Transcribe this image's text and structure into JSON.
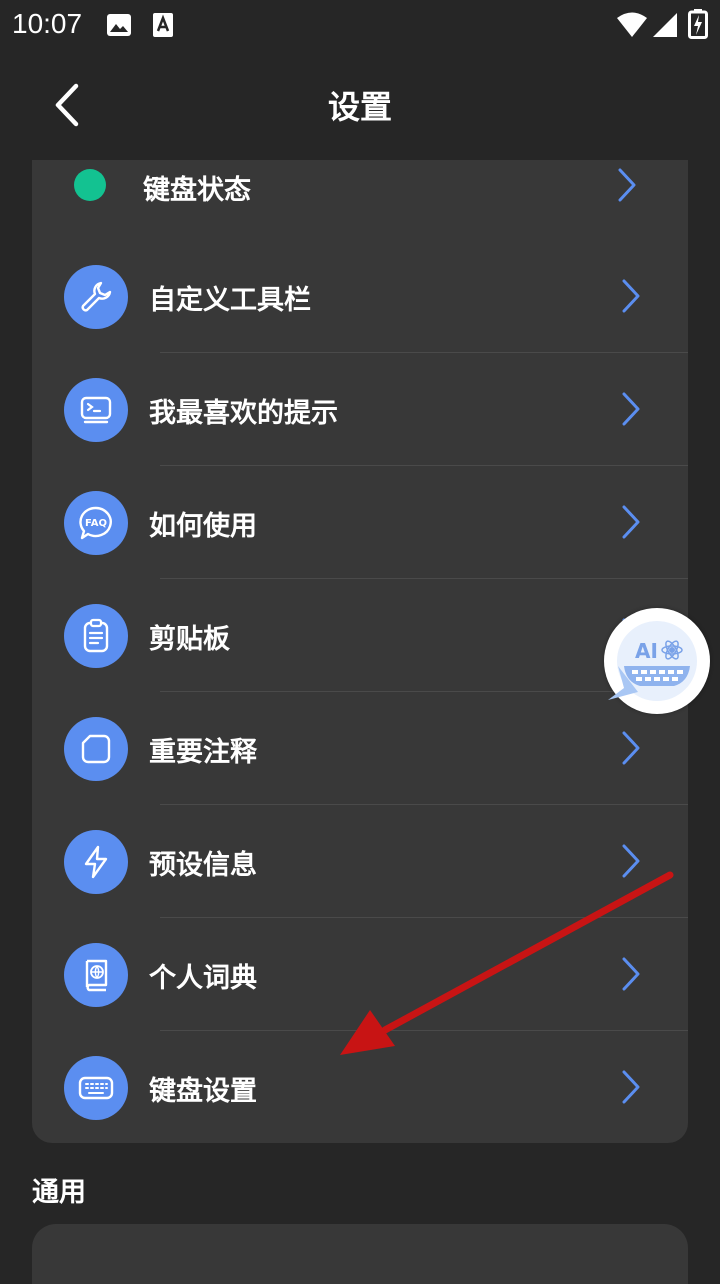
{
  "status_bar": {
    "time": "10:07"
  },
  "header": {
    "title": "设置"
  },
  "items": [
    {
      "label": "键盘状态"
    },
    {
      "label": "自定义工具栏",
      "icon": "wrench-icon"
    },
    {
      "label": "我最喜欢的提示",
      "icon": "terminal-icon"
    },
    {
      "label": "如何使用",
      "icon": "faq-icon",
      "icon_text": "FAQ"
    },
    {
      "label": "剪贴板",
      "icon": "clipboard-icon"
    },
    {
      "label": "重要注释",
      "icon": "note-icon"
    },
    {
      "label": "预设信息",
      "icon": "lightning-icon"
    },
    {
      "label": "个人词典",
      "icon": "dictionary-icon"
    },
    {
      "label": "键盘设置",
      "icon": "keyboard-icon"
    }
  ],
  "section": {
    "title": "通用"
  },
  "fab": {
    "text": "AI"
  },
  "colors": {
    "accent": "#5b8ef0",
    "status_dot": "#13c291",
    "card": "#383838",
    "background": "#262626",
    "arrow": "#c81414"
  }
}
